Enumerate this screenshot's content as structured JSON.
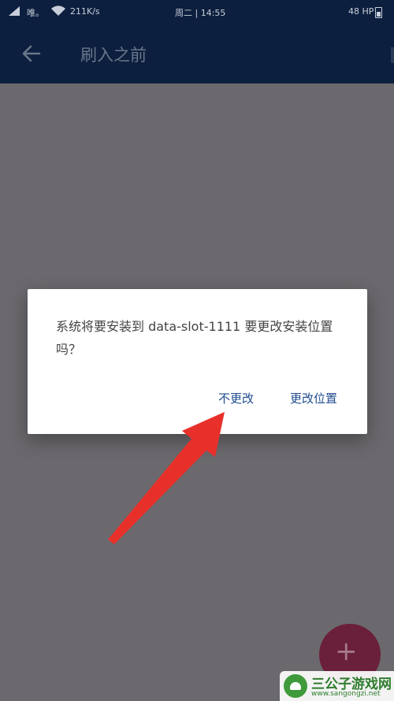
{
  "status_bar": {
    "carrier": "唯。",
    "network_speed": "211K/s",
    "clock": "周二 | 14:55",
    "battery": "48 HP"
  },
  "app_bar": {
    "title": "刷入之前"
  },
  "dialog": {
    "message": "系统将要安装到 data-slot-1111 要更改安装位置吗？",
    "negative_button": "不更改",
    "positive_button": "更改位置"
  },
  "fab": {
    "icon": "plus-icon"
  },
  "annotation": {
    "arrow_color": "#e8302a"
  },
  "watermark": {
    "title": "三公子游戏网",
    "url": "www.sangongzi.net"
  },
  "colors": {
    "app_bar": "#0c1f3e",
    "overlay_background": "#6b696d",
    "dialog_button": "#1e4b8f",
    "fab": "#6a1f3a"
  }
}
